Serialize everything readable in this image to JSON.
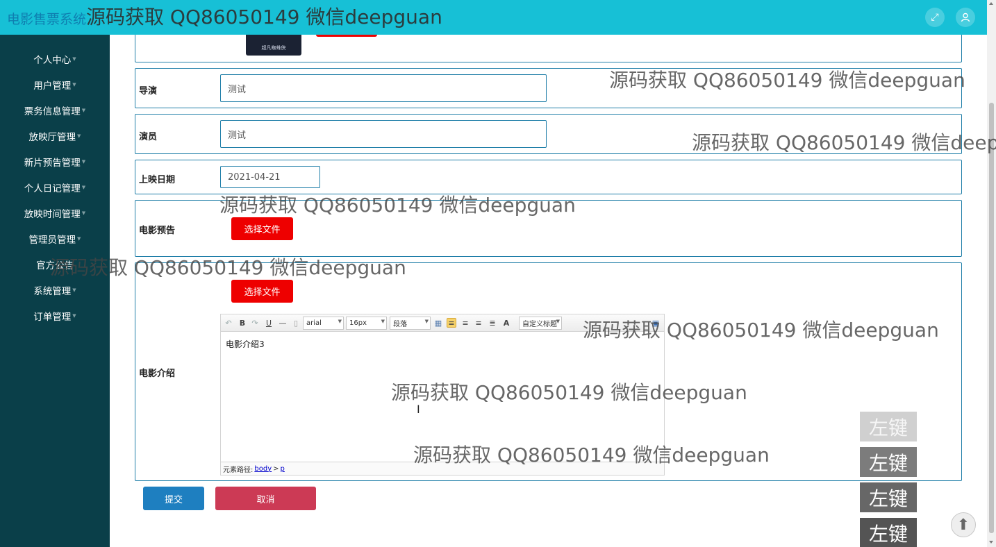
{
  "header": {
    "app_title": "电影售票系统",
    "fullscreen_icon": "expand-icon",
    "user_icon": "user-icon"
  },
  "sidebar": {
    "items": [
      {
        "label": "个人中心"
      },
      {
        "label": "用户管理"
      },
      {
        "label": "票务信息管理"
      },
      {
        "label": "放映厅管理"
      },
      {
        "label": "新片预告管理"
      },
      {
        "label": "个人日记管理"
      },
      {
        "label": "放映时间管理"
      },
      {
        "label": "管理员管理"
      },
      {
        "label": "官方公告"
      },
      {
        "label": "系统管理"
      },
      {
        "label": "订单管理"
      }
    ]
  },
  "form": {
    "poster_thumb_text": "超凡蜘蛛侠",
    "director": {
      "label": "导演",
      "value": "测试"
    },
    "actors": {
      "label": "演员",
      "value": "测试"
    },
    "release_date": {
      "label": "上映日期",
      "value": "2021-04-21"
    },
    "trailer": {
      "label": "电影预告",
      "button": "选择文件"
    },
    "intro": {
      "label": "电影介绍",
      "button": "选择文件",
      "editor": {
        "font_family": "arial",
        "font_size": "16px",
        "paragraph": "段落",
        "custom_title": "自定义标题",
        "content": "电影介绍3",
        "path_label": "元素路径:",
        "path_body": "body",
        "path_sep": ">",
        "path_p": "p"
      }
    },
    "submit_label": "提交",
    "cancel_label": "取消"
  },
  "watermark_text": "源码获取 QQ86050149 微信deepguan",
  "overlay": {
    "left_click_label": "左键",
    "back_to_top_icon": "arrow-up-icon"
  },
  "colors": {
    "header_bg": "#17c0d6",
    "sidebar_bg": "#0a3f49",
    "border_blue": "#1f7ea8",
    "file_button": "#ee0000",
    "submit": "#1e7fc0",
    "cancel": "#cc3a55"
  }
}
